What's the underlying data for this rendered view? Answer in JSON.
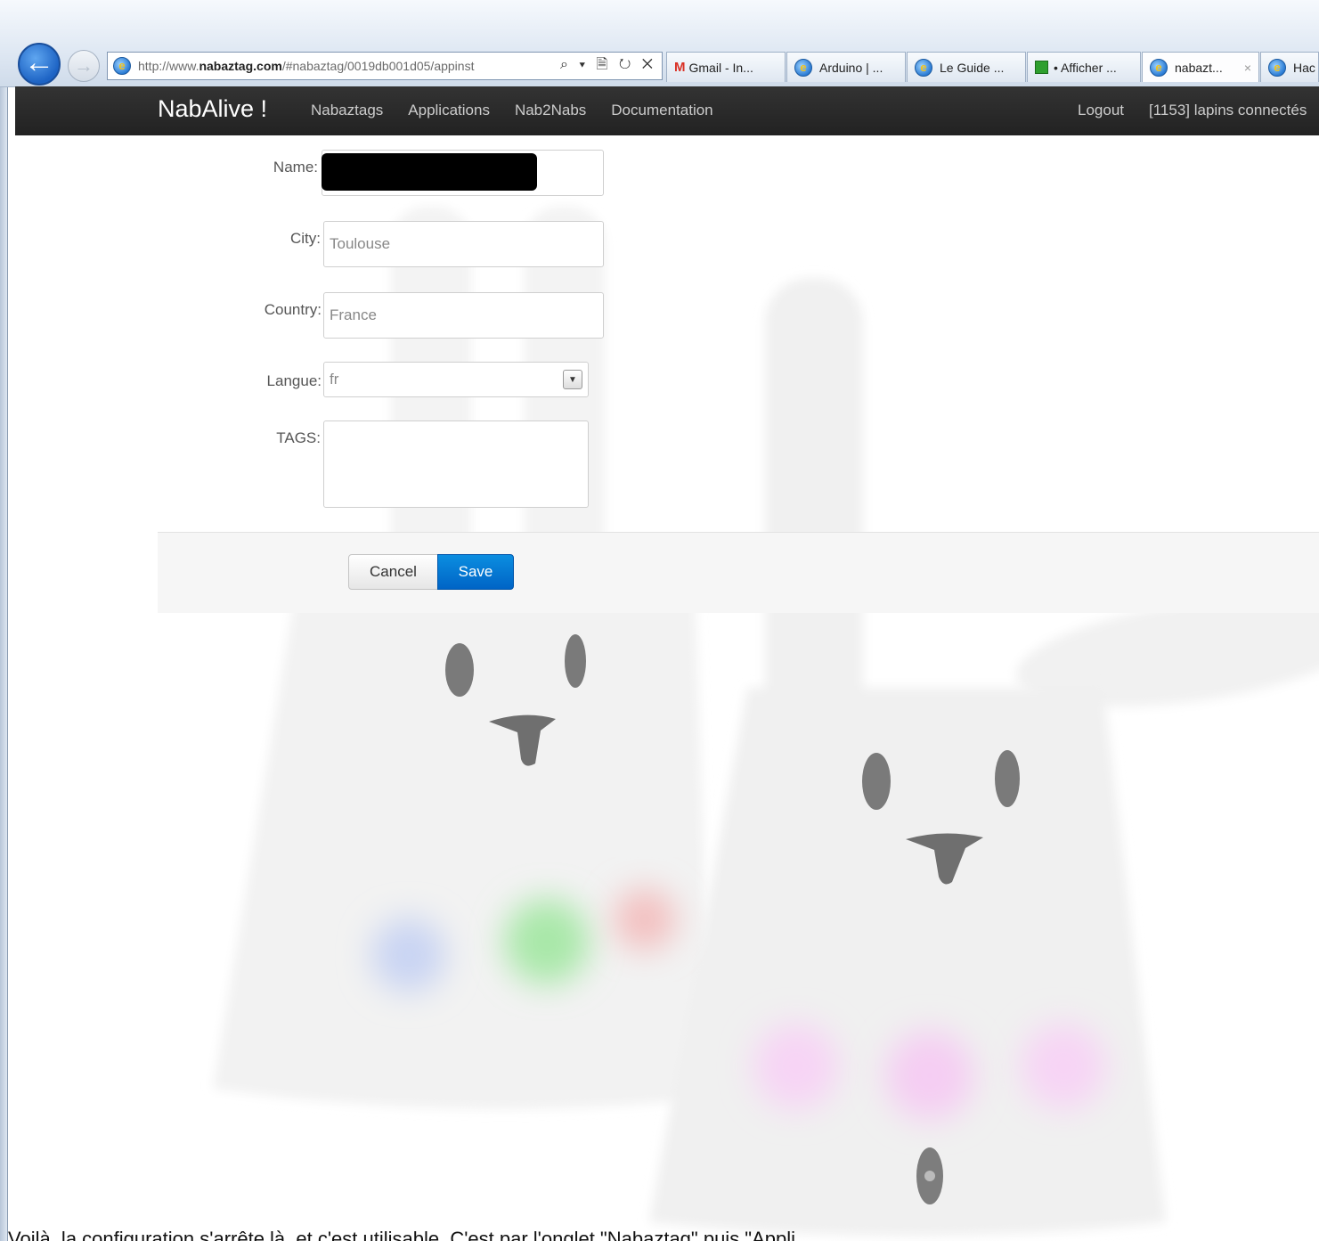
{
  "browser": {
    "url_prefix": "http://www.",
    "url_domain": "nabaztag.com",
    "url_path": "/#nabaztag/0019db001d05/appinst",
    "url_controls": "⌕ ▾ 🗎 ↻ ✕",
    "tabs": [
      {
        "label": "Gmail - In..."
      },
      {
        "label": "Arduino | ..."
      },
      {
        "label": "Le Guide ..."
      },
      {
        "label": "• Afficher ..."
      },
      {
        "label": "nabazt...",
        "close": "×"
      },
      {
        "label": "Hac"
      }
    ]
  },
  "navbar": {
    "brand": "NabAlive !",
    "links": [
      "Nabaztags",
      "Applications",
      "Nab2Nabs",
      "Documentation"
    ],
    "logout": "Logout",
    "connected": "[1153] lapins connectés"
  },
  "form": {
    "name_label": "Name:",
    "city_label": "City:",
    "city_value": "Toulouse",
    "country_label": "Country:",
    "country_value": "France",
    "langue_label": "Langue:",
    "langue_value": "fr",
    "tags_label": "TAGS:",
    "tags_value": "",
    "cancel_label": "Cancel",
    "save_label": "Save"
  },
  "caption": "Voilà, la configuration s'arrête là, et c'est utilisable. C'est par l'onglet \"Nabaztag\" puis \"Appli"
}
